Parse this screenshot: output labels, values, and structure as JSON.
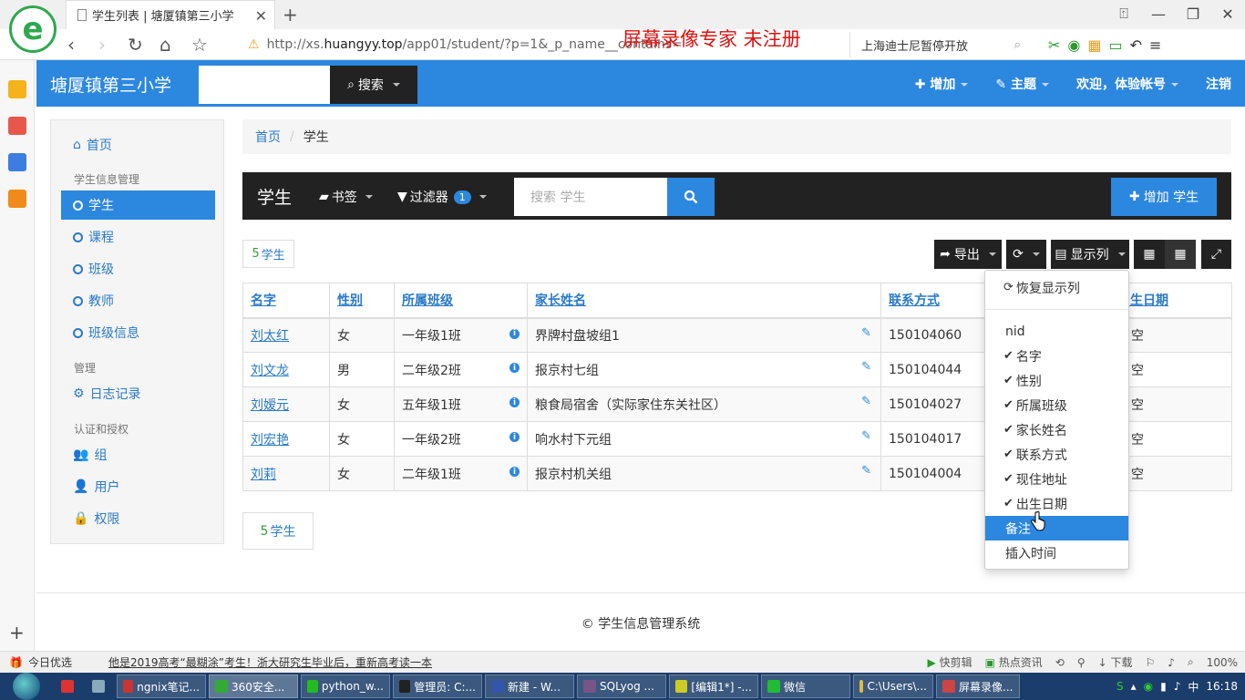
{
  "browser": {
    "tab_title": "学生列表 | 塘厦镇第三小学",
    "url_prefix": "http://xs.",
    "url_host": "huangyy.top",
    "url_path": "/app01/student/?p=1&_p_name__contains=",
    "search_text": "上海迪士尼暂停开放",
    "watermark": "屏幕录像专家  未注册"
  },
  "navbar": {
    "brand": "塘厦镇第三小学",
    "search_button": "搜索",
    "add": "增加",
    "theme": "主题",
    "welcome": "欢迎，体验帐号",
    "logout": "注销"
  },
  "sidebar": {
    "home": "首页",
    "group1": "学生信息管理",
    "items": [
      "学生",
      "课程",
      "班级",
      "教师",
      "班级信息"
    ],
    "group2": "管理",
    "log": "日志记录",
    "group3": "认证和授权",
    "auth": [
      "组",
      "用户",
      "权限"
    ]
  },
  "breadcrumb": {
    "home": "首页",
    "current": "学生"
  },
  "toolbar": {
    "title": "学生",
    "bookmarks": "书签",
    "filter": "过滤器",
    "filter_count": "1",
    "search_placeholder": "搜索 学生",
    "add_student": "增加 学生"
  },
  "count": {
    "number": "5",
    "label": "学生"
  },
  "actions": {
    "export": "导出",
    "show_columns": "显示列"
  },
  "table": {
    "headers": [
      "名字",
      "性别",
      "所属班级",
      "家长姓名",
      "联系方式",
      "出生日期"
    ],
    "rows": [
      {
        "name": "刘太红",
        "gender": "女",
        "class": "一年级1班",
        "parent": "界牌村盘坡组1",
        "phone": "150104060",
        "birth": "空"
      },
      {
        "name": "刘文龙",
        "gender": "男",
        "class": "二年级2班",
        "parent": "报京村七组",
        "phone": "150104044",
        "birth": "空"
      },
      {
        "name": "刘嫒元",
        "gender": "女",
        "class": "五年级1班",
        "parent": "粮食局宿舍（实际家住东关社区）",
        "phone": "150104027",
        "birth": "空"
      },
      {
        "name": "刘宏艳",
        "gender": "女",
        "class": "一年级2班",
        "parent": "响水村下元组",
        "phone": "150104017",
        "birth": "空"
      },
      {
        "name": "刘莉",
        "gender": "女",
        "class": "二年级1班",
        "parent": "报京村机关组",
        "phone": "150104004",
        "birth": "空"
      }
    ]
  },
  "dropdown": {
    "restore": "恢复显示列",
    "items": [
      {
        "label": "nid",
        "checked": false
      },
      {
        "label": "名字",
        "checked": true
      },
      {
        "label": "性别",
        "checked": true
      },
      {
        "label": "所属班级",
        "checked": true
      },
      {
        "label": "家长姓名",
        "checked": true
      },
      {
        "label": "联系方式",
        "checked": true
      },
      {
        "label": "现住地址",
        "checked": true
      },
      {
        "label": "出生日期",
        "checked": true
      },
      {
        "label": "备注",
        "checked": false,
        "active": true
      },
      {
        "label": "插入时间",
        "checked": false
      }
    ]
  },
  "footer": "© 学生信息管理系统",
  "statusbar": {
    "today": "今日优选",
    "news": "他是2019高考“最糊涂”考生！浙大研究生毕业后，重新高考读一本",
    "quick_edit": "快剪辑",
    "hot_news": "热点资讯",
    "download": "下载",
    "zoom": "100%"
  },
  "taskbar": {
    "tasks": [
      "ngnix笔记...",
      "360安全...",
      "python_w...",
      "管理员: C:...",
      "新建 - W...",
      "SQLyog ...",
      "[编辑1*] -...",
      "微信",
      "C:\\Users\\...",
      "屏幕录像..."
    ],
    "time": "16:18"
  },
  "colors": {
    "primary": "#2c87df",
    "dark": "#222222",
    "link": "#2a7ac8"
  }
}
